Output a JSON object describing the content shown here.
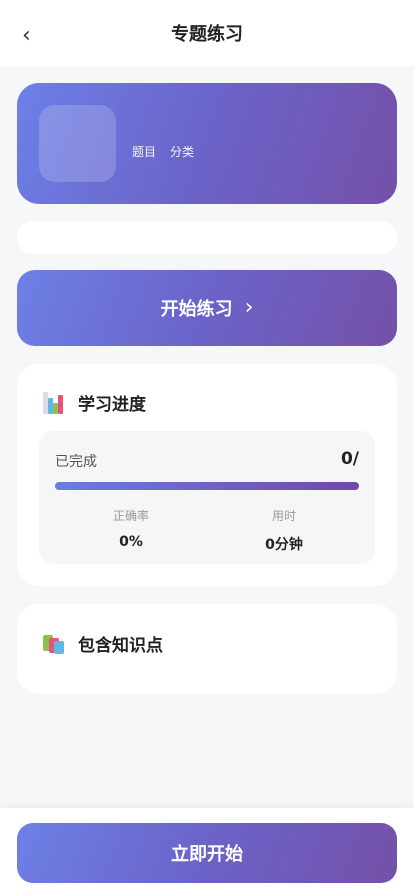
{
  "header": {
    "title": "专题练习",
    "back_glyph": "‹",
    "back_icon": "chevron-left-icon"
  },
  "hero": {
    "tags": [
      "题目",
      "分类"
    ]
  },
  "start_button": {
    "label": "开始练习",
    "chevron": "›"
  },
  "progress": {
    "title": "学习进度",
    "icon": "bar-chart-icon",
    "completed_label": "已完成",
    "completed_value": "0/",
    "progress_fraction": 1.0,
    "accuracy_label": "正确率",
    "accuracy_value": "0%",
    "time_label": "用时",
    "time_value": "0分钟"
  },
  "knowledge": {
    "title": "包含知识点",
    "icon": "books-icon"
  },
  "footer": {
    "button_label": "立即开始"
  },
  "colors": {
    "gradient_start": "#6d80e6",
    "gradient_end": "#7450a8",
    "background": "#f6f7f9"
  }
}
